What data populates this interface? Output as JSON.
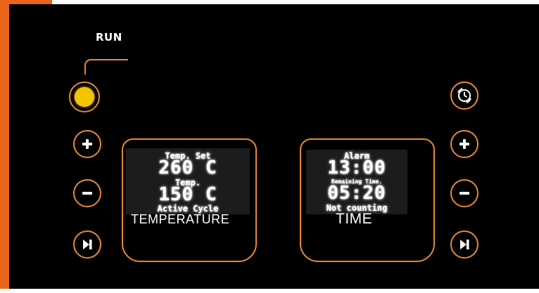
{
  "colors": {
    "accent": "#e8892e",
    "side_strip": "#e8651a",
    "run_lamp": "#f5c400",
    "panel_bg": "#000000",
    "lcd_bg": "#1c1c1c"
  },
  "run": {
    "label": "RUN",
    "lamp_state": "on"
  },
  "left_controls": [
    {
      "icon": "plus-icon"
    },
    {
      "icon": "minus-icon"
    },
    {
      "icon": "skip-next-icon"
    }
  ],
  "right_controls": [
    {
      "icon": "clock-cycle-icon"
    },
    {
      "icon": "plus-icon"
    },
    {
      "icon": "minus-icon"
    },
    {
      "icon": "skip-next-icon"
    }
  ],
  "temperature": {
    "set_label": "Temp. Set",
    "set_value": "260 C",
    "current_label": "Temp.",
    "current_value": "150 C",
    "status": "Active Cycle",
    "caption": "TEMPERATURE"
  },
  "time": {
    "alarm_label": "Alarm",
    "alarm_value": "13:00",
    "remaining_label": "Remaining Time.",
    "remaining_value": "05:20",
    "status": "Not counting",
    "caption": "TIME"
  }
}
